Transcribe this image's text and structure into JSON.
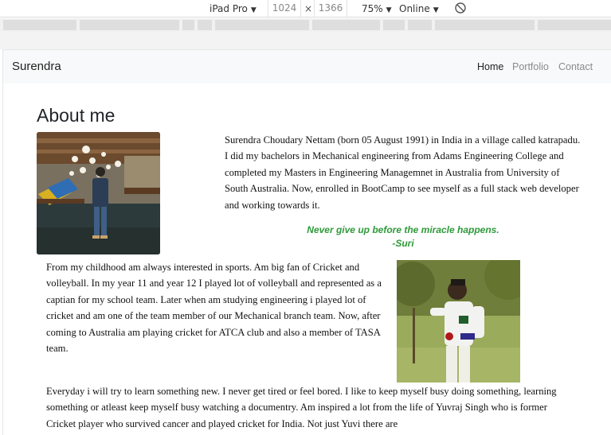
{
  "devtools": {
    "device": "iPad Pro",
    "width": "1024",
    "times": "×",
    "height": "1366",
    "zoom": "75%",
    "network": "Online",
    "caret": "▼",
    "rotate_icon": "rotate-icon"
  },
  "navbar": {
    "brand": "Surendra",
    "links": [
      "Home",
      "Portfolio",
      "Contact"
    ]
  },
  "about": {
    "title": "About me",
    "para1": "Surendra Choudary Nettam (born 05 August 1991) in India in a village called katrapadu. I did my bachelors in Mechanical engineering from Adams Engineering College and completed my Masters in Engineering Managemnet in Australia from University of South Australia. Now, enrolled in BootCamp to see myself as a full stack web developer and working towards it.",
    "quote_line": "Never give up before the miracle happens.",
    "quote_author": "-Suri",
    "para2": "From my childhood am always interested in sports. Am big fan of Cricket and volleyball. In my year 11 and year 12 I played lot of volleyball and represented as a captian for my school team. Later when am studying engineering i played lot of cricket and am one of the team member of our Mechanical branch team. Now, after coming to Australia am playing cricket for ATCA club and also a member of TASA team.",
    "para3": "Everyday i will try to learn something new. I never get tired or feel bored. I like to keep myself busy doing something, learning something or atleast keep myself busy watching a documentry. Am inspired a lot from the life of Yuvraj Singh who is former Cricket player who survived cancer and played cricket for India. Not just Yuvi there are"
  }
}
